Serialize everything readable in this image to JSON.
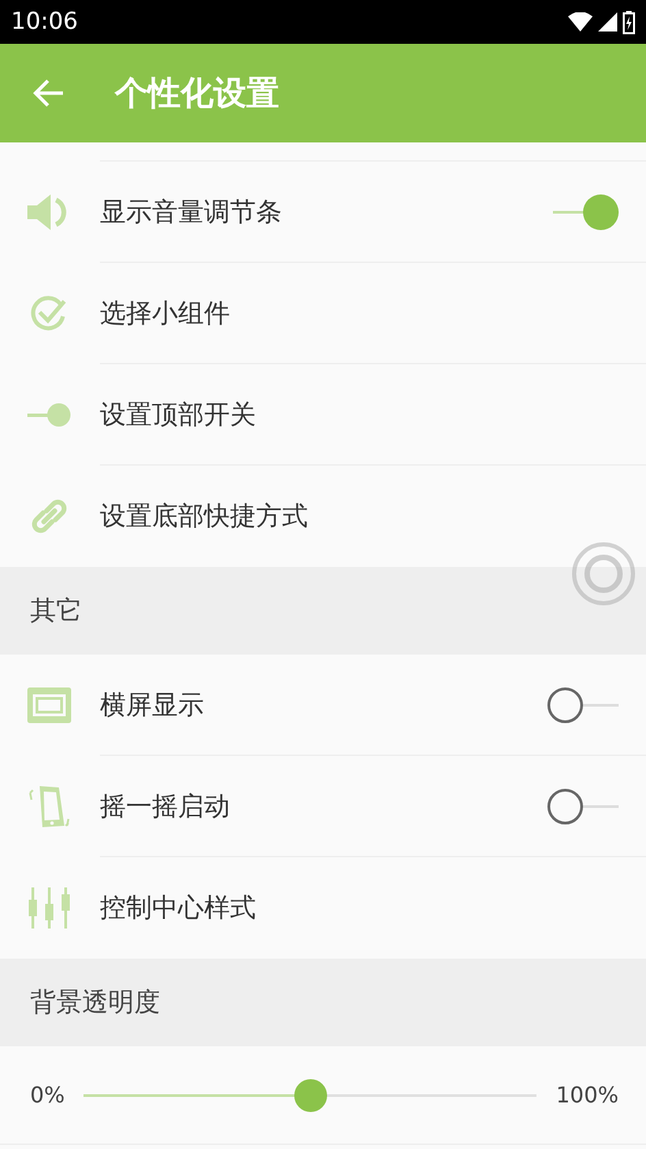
{
  "status_bar": {
    "time": "10:06"
  },
  "app_bar": {
    "title": "个性化设置"
  },
  "sections": [
    {
      "items": [
        {
          "label": "显示音量调节条",
          "kind": "toggle",
          "on": true
        },
        {
          "label": "选择小组件",
          "kind": "link"
        },
        {
          "label": "设置顶部开关",
          "kind": "link"
        },
        {
          "label": "设置底部快捷方式",
          "kind": "link"
        }
      ]
    },
    {
      "header": "其它",
      "items": [
        {
          "label": "横屏显示",
          "kind": "toggle",
          "on": false
        },
        {
          "label": "摇一摇启动",
          "kind": "toggle",
          "on": false
        },
        {
          "label": "控制中心样式",
          "kind": "link"
        }
      ]
    },
    {
      "header": "背景透明度",
      "slider": {
        "min_label": "0%",
        "max_label": "100%",
        "level": 0.5
      }
    }
  ]
}
